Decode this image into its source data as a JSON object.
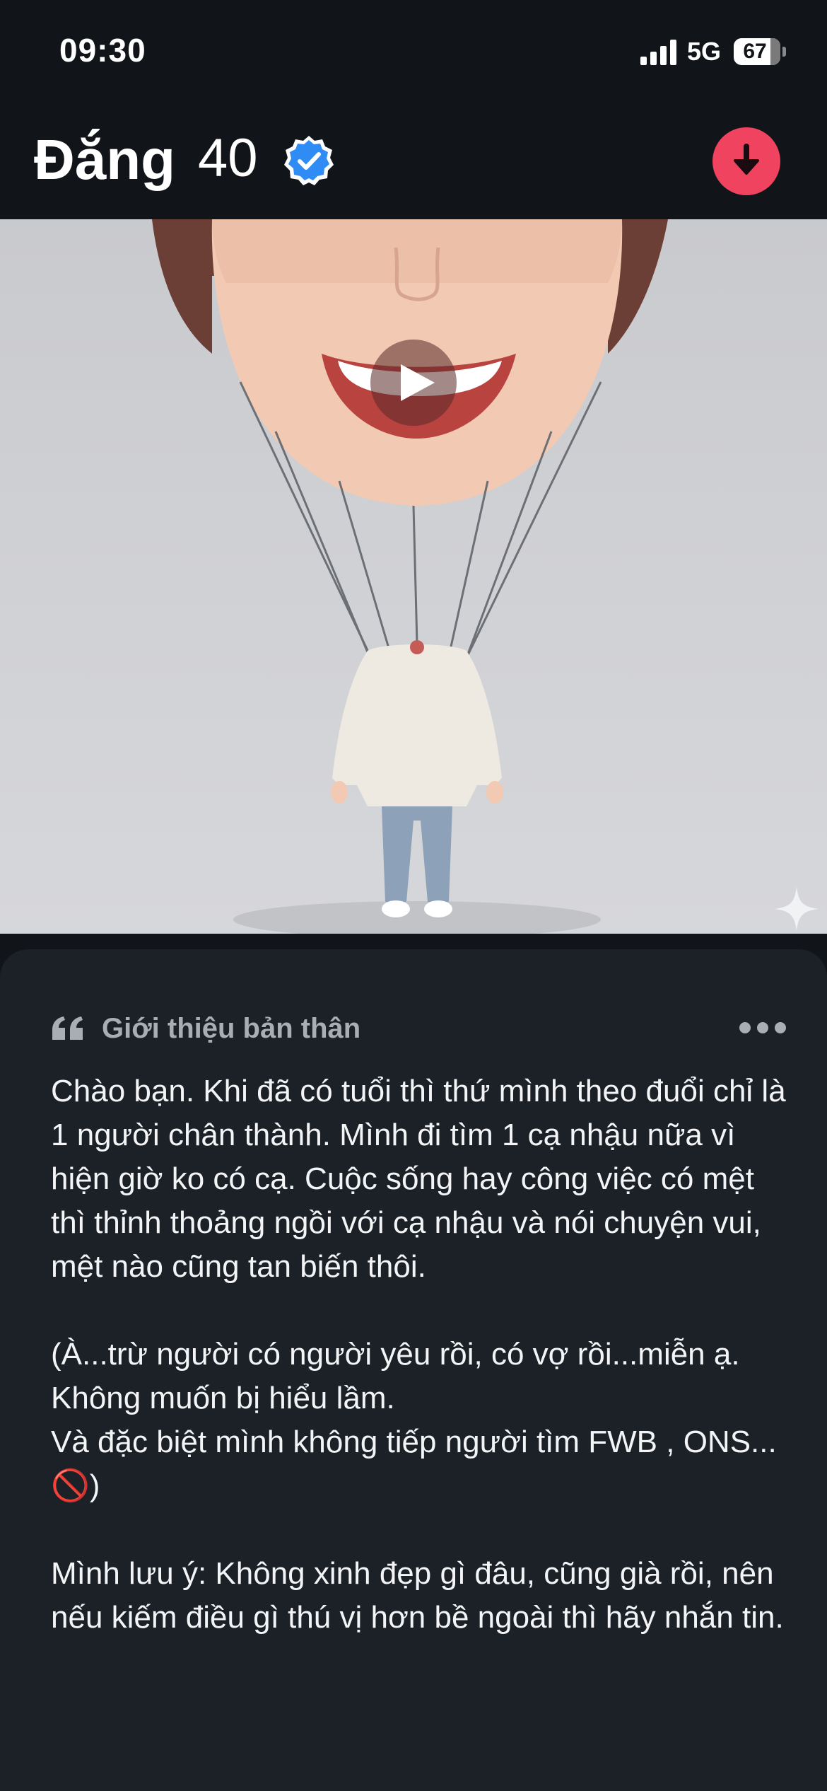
{
  "status_bar": {
    "time": "09:30",
    "network": "5G",
    "battery": "67"
  },
  "profile": {
    "name": "Đắng",
    "age": "40"
  },
  "bio": {
    "title": "Giới thiệu bản thân",
    "text": "Chào bạn. Khi đã có tuổi thì thứ mình theo đuổi chỉ là 1 người chân thành. Mình đi tìm 1 cạ nhậu nữa vì hiện giờ ko có cạ. Cuộc sống hay công việc có mệt thì thỉnh thoảng ngồi với cạ nhậu và nói chuyện vui, mệt nào cũng tan biến thôi.\n\n(À...trừ người có người yêu rồi, có vợ rồi...miễn ạ. Không muốn bị hiểu lầm.\nVà đặc biệt mình không tiếp người tìm FWB , ONS...🚫)\n\nMình lưu ý: Không xinh đẹp gì đâu, cũng già rồi, nên nếu kiếm điều gì thú vị hơn bề ngoài thì hãy nhắn tin."
  },
  "colors": {
    "background": "#111418",
    "card": "#1c2027",
    "accent": "#f0435f",
    "verified": "#2f8cf5",
    "muted_text": "#a9adb6"
  },
  "icons": {
    "signal": "signal-icon",
    "battery": "battery-icon",
    "verified": "verified-badge-icon",
    "download": "download-arrow-icon",
    "play": "play-icon",
    "quote": "quote-icon",
    "more": "more-dots-icon",
    "sparkle": "sparkle-icon"
  }
}
